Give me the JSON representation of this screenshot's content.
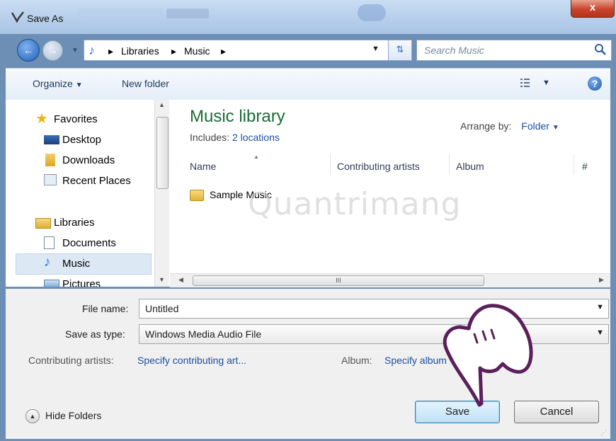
{
  "window": {
    "title": "Save As",
    "close_glyph": "x"
  },
  "address": {
    "crumbs": [
      "Libraries",
      "Music"
    ],
    "search_placeholder": "Search Music"
  },
  "toolbar": {
    "organize": "Organize",
    "new_folder": "New folder"
  },
  "nav": {
    "items": [
      {
        "label": "Favorites",
        "icon": "star-icon"
      },
      {
        "label": "Desktop",
        "icon": "desktop-icon"
      },
      {
        "label": "Downloads",
        "icon": "downloads-icon"
      },
      {
        "label": "Recent Places",
        "icon": "recent-places-icon"
      },
      {
        "label": "Libraries",
        "icon": "libraries-icon"
      },
      {
        "label": "Documents",
        "icon": "documents-icon"
      },
      {
        "label": "Music",
        "icon": "music-icon",
        "selected": true
      },
      {
        "label": "Pictures",
        "icon": "pictures-icon"
      }
    ]
  },
  "library": {
    "title": "Music library",
    "includes_label": "Includes:",
    "includes_link": "2 locations",
    "arrange_label": "Arrange by:",
    "arrange_value": "Folder"
  },
  "columns": [
    "Name",
    "Contributing artists",
    "Album",
    "#"
  ],
  "files": [
    {
      "name": "Sample Music",
      "type": "folder"
    }
  ],
  "watermark": "Quantrimang",
  "hscroll_glyph": "III",
  "form": {
    "file_name_label": "File name:",
    "file_name_value": "Untitled",
    "save_type_label": "Save as type:",
    "save_type_value": "Windows Media Audio File",
    "artists_label": "Contributing artists:",
    "artists_link": "Specify contributing art...",
    "album_label": "Album:",
    "album_link": "Specify album"
  },
  "buttons": {
    "hide_folders": "Hide Folders",
    "save": "Save",
    "cancel": "Cancel"
  },
  "colors": {
    "title_green": "#1b6c35",
    "link_blue": "#1d4ea0",
    "close_red": "#c8442a"
  }
}
